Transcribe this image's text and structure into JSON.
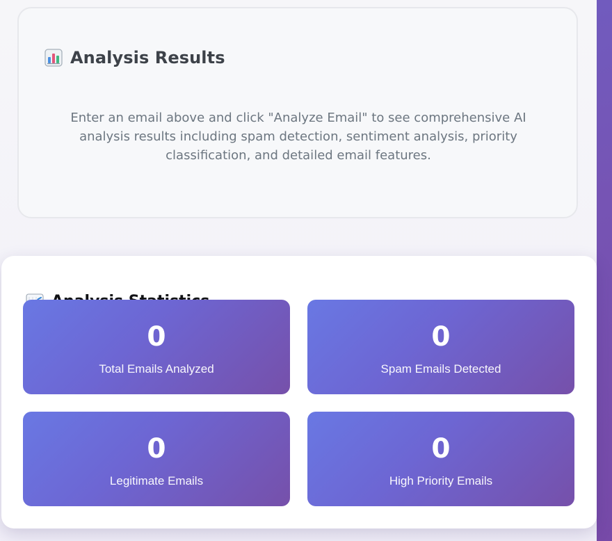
{
  "results": {
    "title": "Analysis Results",
    "message": "Enter an email above and click \"Analyze Email\" to see comprehensive AI analysis results including spam detection, sentiment analysis, priority classification, and detailed email features.",
    "icon": "bar-chart-icon"
  },
  "statistics": {
    "title": "Analysis Statistics",
    "icon": "trend-up-icon",
    "cards": [
      {
        "value": "0",
        "label": "Total Emails Analyzed"
      },
      {
        "value": "0",
        "label": "Spam Emails Detected"
      },
      {
        "value": "0",
        "label": "Legitimate Emails"
      },
      {
        "value": "0",
        "label": "High Priority Emails"
      }
    ]
  },
  "colors": {
    "background": "#7654b4",
    "panel": "#f7f8fa",
    "tile_start": "#6978e3",
    "tile_end": "#7650aa",
    "text_muted": "#6c7680",
    "text_dark": "#101114"
  }
}
